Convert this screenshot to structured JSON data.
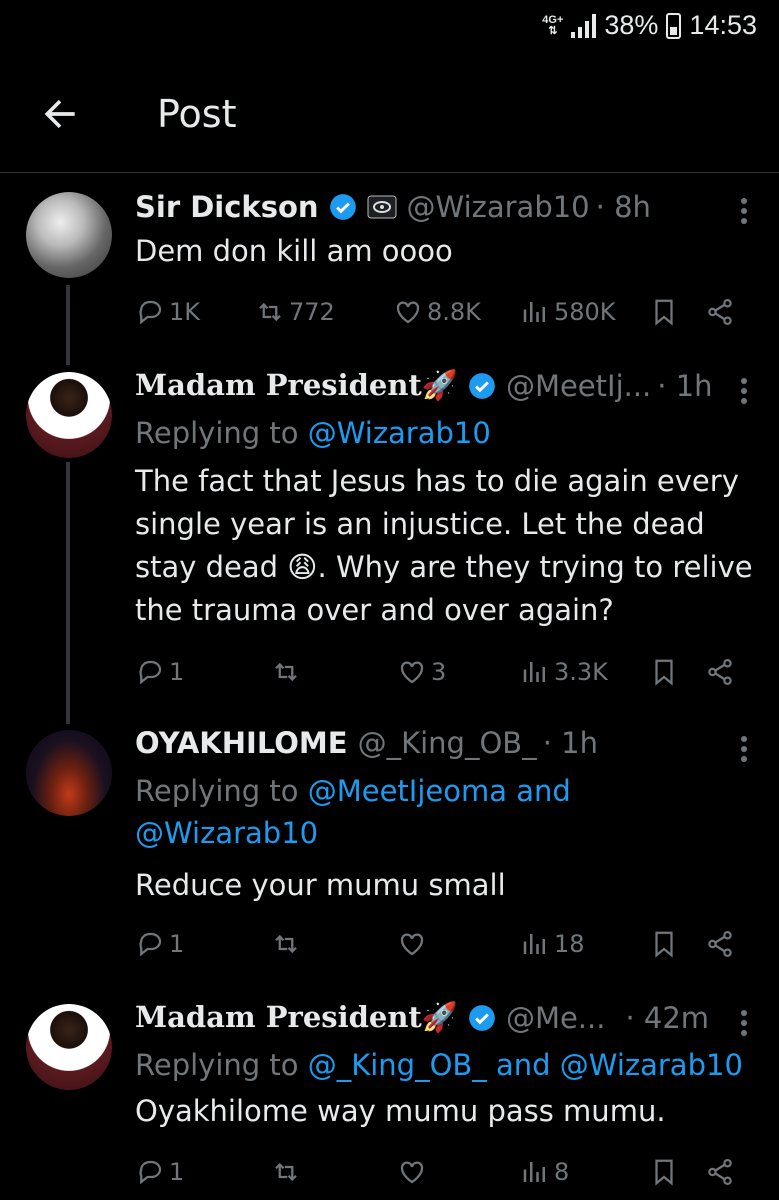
{
  "status_bar": {
    "network": "4G+",
    "battery": "38%",
    "time": "14:53"
  },
  "header": {
    "title": "Post"
  },
  "tweets": [
    {
      "name": "Sir Dickson",
      "handle": "@Wizarab10",
      "time": "· 8h",
      "reply_prefix": "",
      "reply_to": "",
      "text": "Dem don kill am oooo",
      "replies": "1K",
      "reposts": "772",
      "likes": "8.8K",
      "views": "580K"
    },
    {
      "name": "Madam President🚀",
      "handle": "@MeetIj...",
      "time": "· 1h",
      "reply_prefix": "Replying to ",
      "reply_to": "@Wizarab10",
      "text": "The fact that Jesus has to die again every single year is an injustice. Let the dead stay dead 😩. Why are they trying to relive the trauma over and over again?",
      "replies": "1",
      "reposts": "",
      "likes": "3",
      "views": "3.3K"
    },
    {
      "name": "OYAKHILOME",
      "handle": "@_King_OB_",
      "time": "· 1h",
      "reply_prefix": "Replying to ",
      "reply_to": "@MeetIjeoma and @Wizarab10",
      "text": "Reduce your mumu small",
      "replies": "1",
      "reposts": "",
      "likes": "",
      "views": "18"
    },
    {
      "name": "Madam President🚀",
      "handle": "@Me...",
      "time": "· 42m",
      "reply_prefix": "Replying to ",
      "reply_to": "@_King_OB_ and @Wizarab10",
      "text": "Oyakhilome way mumu pass mumu.",
      "replies": "1",
      "reposts": "",
      "likes": "",
      "views": "8"
    }
  ],
  "colors": {
    "background": "#000000",
    "text": "#e7e9ea",
    "secondary": "#71767b",
    "link": "#1d9bf0",
    "verified": "#1d9bf0"
  }
}
